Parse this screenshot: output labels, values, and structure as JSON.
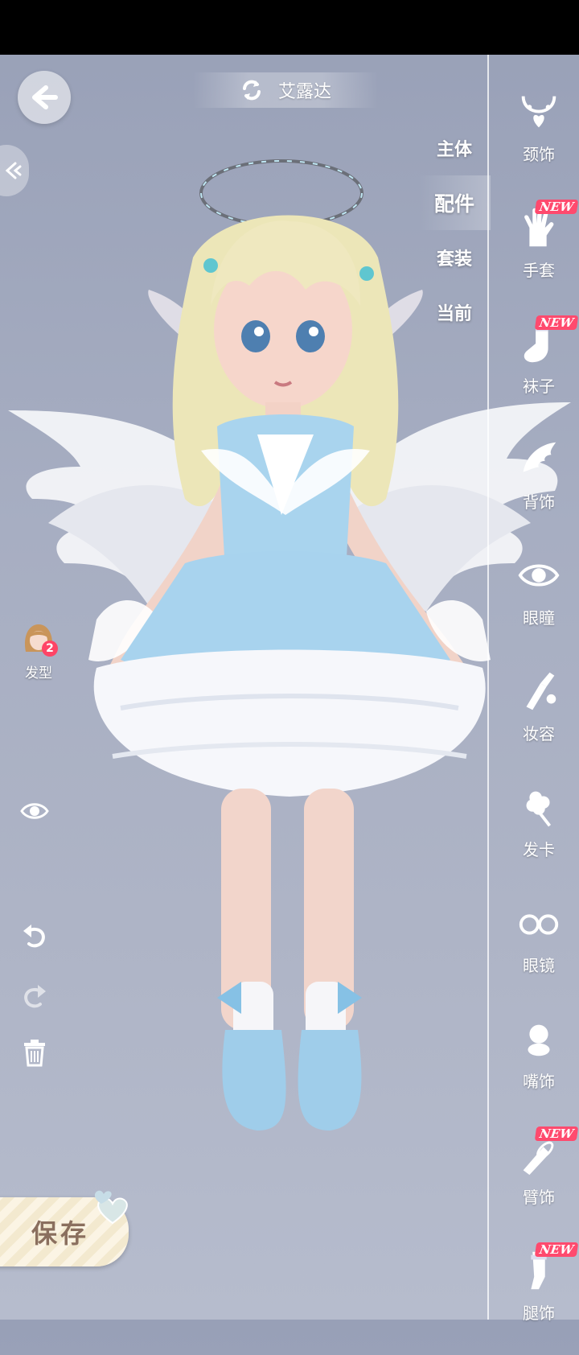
{
  "header": {
    "character_name": "艾露达"
  },
  "category_tabs": [
    {
      "label": "主体",
      "active": false
    },
    {
      "label": "配件",
      "active": true
    },
    {
      "label": "套装",
      "active": false
    },
    {
      "label": "当前",
      "active": false
    }
  ],
  "slots": [
    {
      "label": "颈饰",
      "icon": "necklace-icon",
      "new": false
    },
    {
      "label": "手套",
      "icon": "glove-icon",
      "new": true
    },
    {
      "label": "袜子",
      "icon": "sock-icon",
      "new": true
    },
    {
      "label": "背饰",
      "icon": "wing-icon",
      "new": false
    },
    {
      "label": "眼瞳",
      "icon": "eye-icon",
      "new": false
    },
    {
      "label": "妆容",
      "icon": "makeup-brush-icon",
      "new": false
    },
    {
      "label": "发卡",
      "icon": "hairpin-icon",
      "new": false
    },
    {
      "label": "眼镜",
      "icon": "glasses-icon",
      "new": false
    },
    {
      "label": "嘴饰",
      "icon": "pacifier-icon",
      "new": false
    },
    {
      "label": "臂饰",
      "icon": "armlet-icon",
      "new": true
    },
    {
      "label": "腿饰",
      "icon": "legwear-icon",
      "new": true
    }
  ],
  "new_badge_text": "NEW",
  "hair": {
    "label": "发型",
    "count": "2"
  },
  "save": {
    "label": "保存"
  },
  "colors": {
    "accent_new": "#ff4a6e",
    "background": "#a7aec2",
    "save_text": "#8a6f5e"
  }
}
